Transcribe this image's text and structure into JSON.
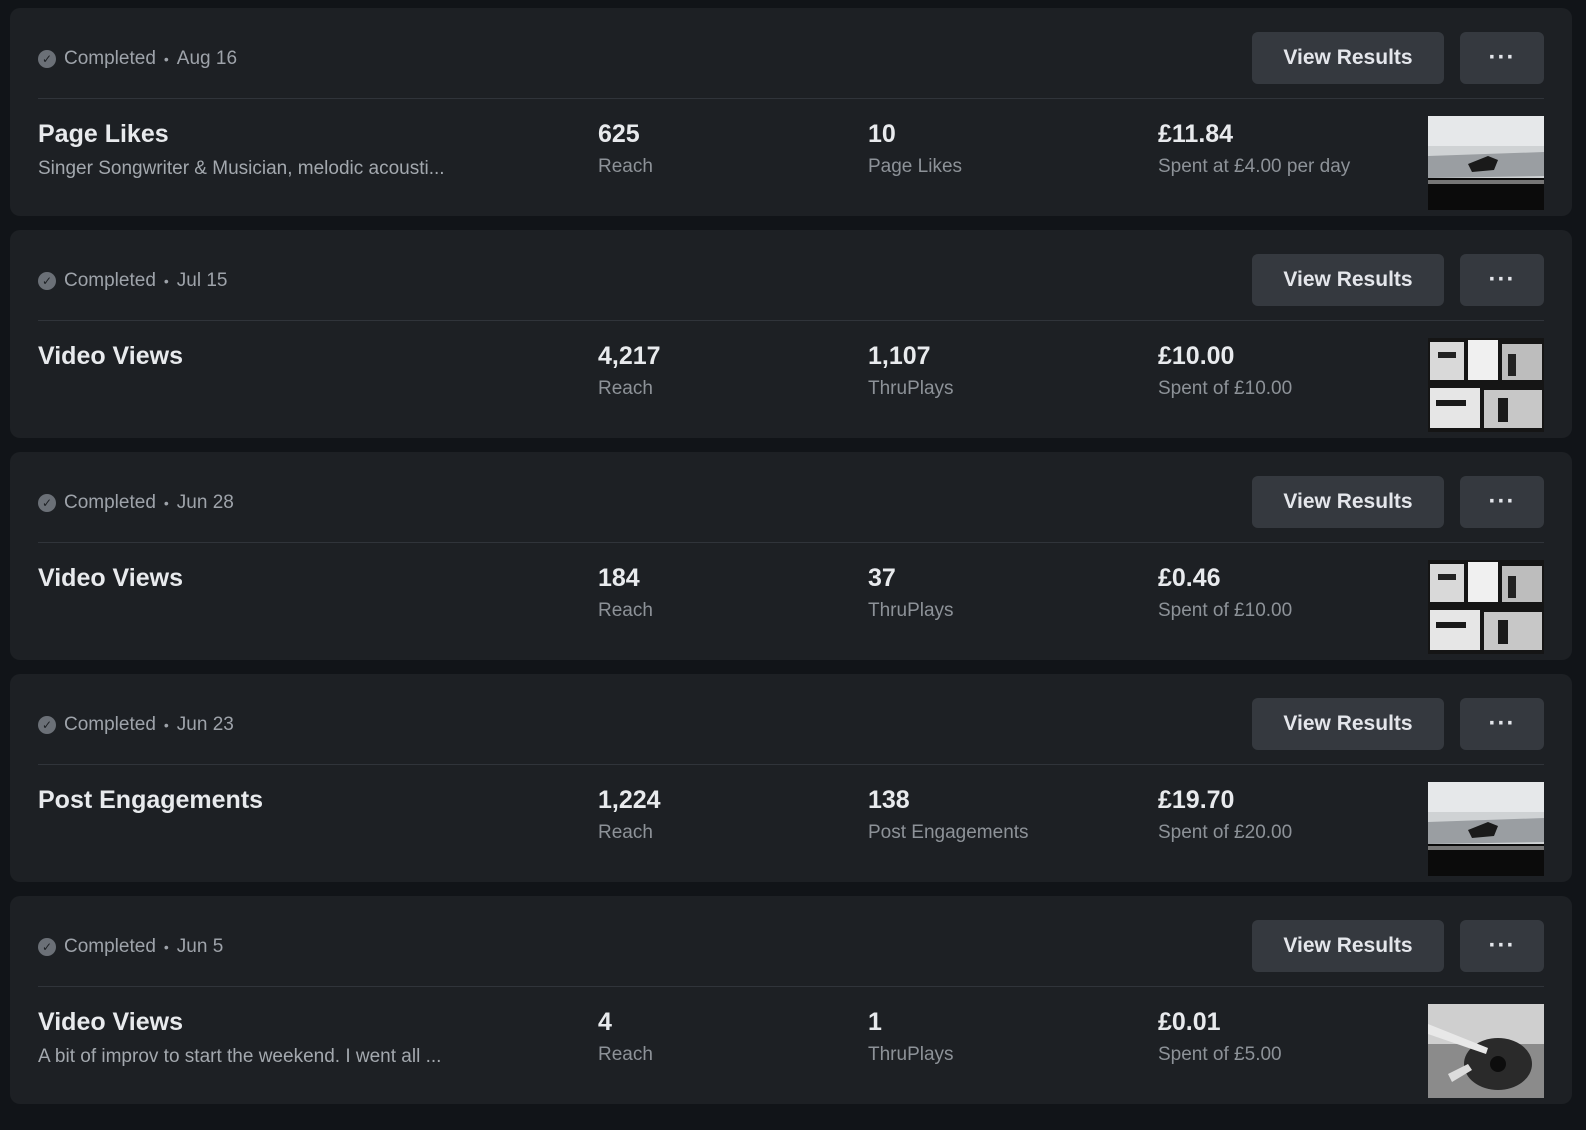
{
  "campaigns": [
    {
      "status": "Completed",
      "date": "Aug 16",
      "view_label": "View Results",
      "more_label": "···",
      "title": "Page Likes",
      "subtitle": "Singer Songwriter & Musician, melodic acousti...",
      "m1": {
        "value": "625",
        "label": "Reach"
      },
      "m2": {
        "value": "10",
        "label": "Page Likes"
      },
      "m3": {
        "value": "£11.84",
        "label": "Spent at £4.00 per day"
      },
      "thumb": "sky-silhouette"
    },
    {
      "status": "Completed",
      "date": "Jul 15",
      "view_label": "View Results",
      "more_label": "···",
      "title": "Video Views",
      "subtitle": "",
      "m1": {
        "value": "4,217",
        "label": "Reach"
      },
      "m2": {
        "value": "1,107",
        "label": "ThruPlays"
      },
      "m3": {
        "value": "£10.00",
        "label": "Spent of £10.00"
      },
      "thumb": "grid-bw"
    },
    {
      "status": "Completed",
      "date": "Jun 28",
      "view_label": "View Results",
      "more_label": "···",
      "title": "Video Views",
      "subtitle": "",
      "m1": {
        "value": "184",
        "label": "Reach"
      },
      "m2": {
        "value": "37",
        "label": "ThruPlays"
      },
      "m3": {
        "value": "£0.46",
        "label": "Spent of £10.00"
      },
      "thumb": "grid-bw"
    },
    {
      "status": "Completed",
      "date": "Jun 23",
      "view_label": "View Results",
      "more_label": "···",
      "title": "Post Engagements",
      "subtitle": "",
      "m1": {
        "value": "1,224",
        "label": "Reach"
      },
      "m2": {
        "value": "138",
        "label": "Post Engagements"
      },
      "m3": {
        "value": "£19.70",
        "label": "Spent of £20.00"
      },
      "thumb": "sky-silhouette"
    },
    {
      "status": "Completed",
      "date": "Jun 5",
      "view_label": "View Results",
      "more_label": "···",
      "title": "Video Views",
      "subtitle": "A bit of improv to start the weekend. I went all ...",
      "m1": {
        "value": "4",
        "label": "Reach"
      },
      "m2": {
        "value": "1",
        "label": "ThruPlays"
      },
      "m3": {
        "value": "£0.01",
        "label": "Spent of £5.00"
      },
      "thumb": "guitar"
    }
  ]
}
